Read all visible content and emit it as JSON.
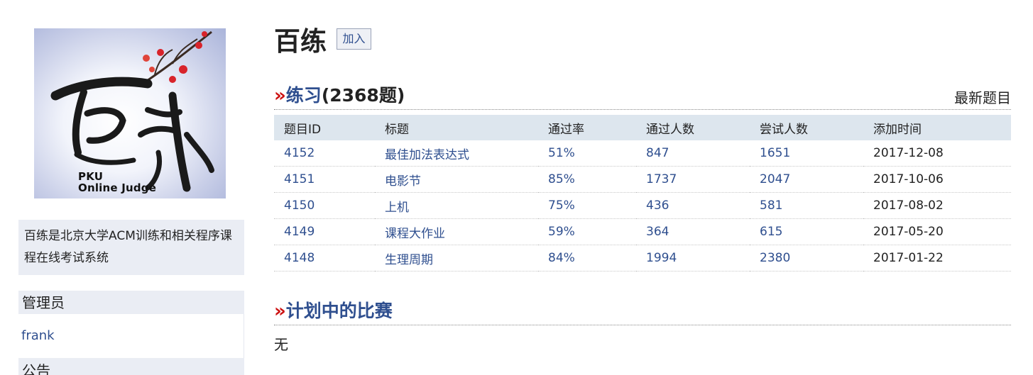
{
  "sidebar": {
    "logo_text": "PKU",
    "logo_text2": "Online Judge",
    "intro": "百练是北京大学ACM训练和相关程序课程在线考试系统",
    "admin_heading": "管理员",
    "admin_name": "frank",
    "notice_heading": "公告"
  },
  "group": {
    "title": "百练",
    "join_label": "加入"
  },
  "practice": {
    "arrow": "»",
    "label": "练习",
    "count": "(2368题)",
    "latest_link": "最新题目",
    "columns": [
      "题目ID",
      "标题",
      "通过率",
      "通过人数",
      "尝试人数",
      "添加时间"
    ],
    "rows": [
      {
        "id": "4152",
        "title": "最佳加法表达式",
        "rate": "51%",
        "accepted": "847",
        "attempted": "1651",
        "date": "2017-12-08"
      },
      {
        "id": "4151",
        "title": "电影节",
        "rate": "85%",
        "accepted": "1737",
        "attempted": "2047",
        "date": "2017-10-06"
      },
      {
        "id": "4150",
        "title": "上机",
        "rate": "75%",
        "accepted": "436",
        "attempted": "581",
        "date": "2017-08-02"
      },
      {
        "id": "4149",
        "title": "课程大作业",
        "rate": "59%",
        "accepted": "364",
        "attempted": "615",
        "date": "2017-05-20"
      },
      {
        "id": "4148",
        "title": "生理周期",
        "rate": "84%",
        "accepted": "1994",
        "attempted": "2380",
        "date": "2017-01-22"
      }
    ]
  },
  "contests": {
    "arrow": "»",
    "label": "计划中的比赛",
    "empty_text": "无"
  },
  "colors": {
    "link": "#2f4f8f",
    "accent_arrow": "#cc1111",
    "panel_bg": "#eaedf4",
    "table_header_bg": "#dde6ee"
  }
}
